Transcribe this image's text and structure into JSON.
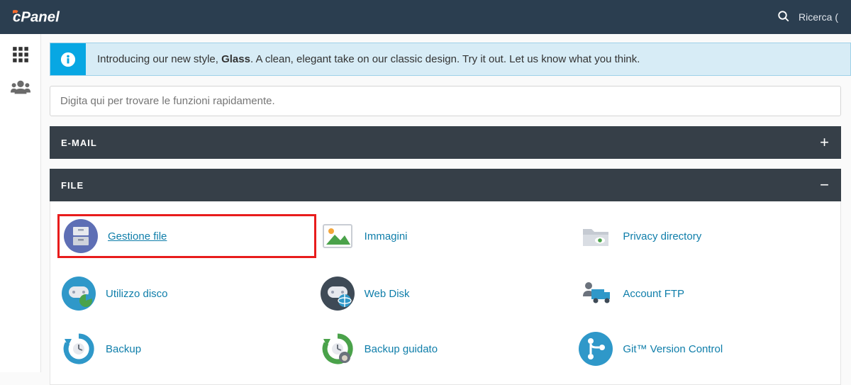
{
  "header": {
    "brand": "cPanel",
    "search_label": "Ricerca ("
  },
  "banner": {
    "pre": "Introducing our new style, ",
    "bold": "Glass",
    "post": ". A clean, elegant take on our classic design. Try it out. Let us know what you think."
  },
  "quick_search_placeholder": "Digita qui per trovare le funzioni rapidamente.",
  "sections": {
    "email": {
      "title": "E-MAIL",
      "toggle": "+"
    },
    "file": {
      "title": "FILE",
      "toggle": "−"
    }
  },
  "file_items": {
    "file_manager": "Gestione file",
    "images": "Immagini",
    "privacy_directory": "Privacy directory",
    "disk_usage": "Utilizzo disco",
    "web_disk": "Web Disk",
    "ftp_accounts": "Account FTP",
    "backup": "Backup",
    "backup_wizard": "Backup guidato",
    "git_version": "Git™ Version Control"
  },
  "colors": {
    "accent": "#0f7eaa",
    "header_bg": "#2b3e50",
    "section_bg": "#363f48",
    "banner_bg": "#d7ecf6",
    "banner_icon_bg": "#08a7e3",
    "highlight": "#e81c1c"
  }
}
